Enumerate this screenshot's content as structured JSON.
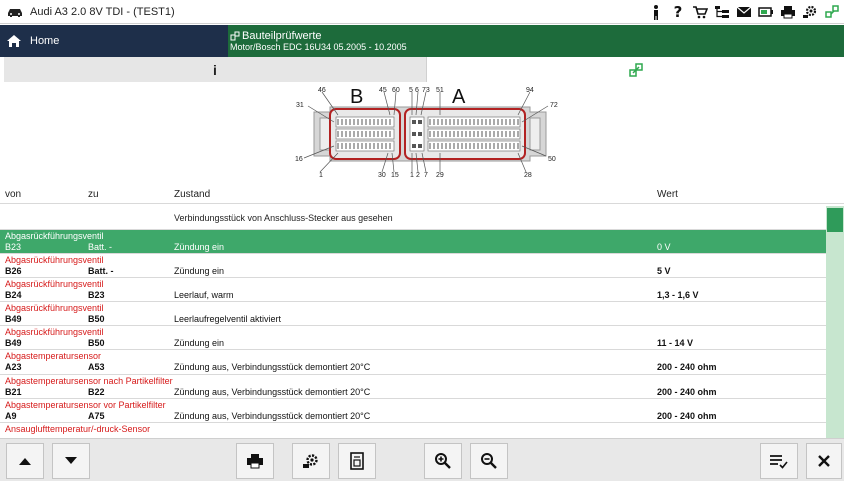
{
  "window": {
    "title": "Audi A3 2.0 8V TDI - (TEST1)"
  },
  "header": {
    "home_label": "Home",
    "module_title": "Bauteilprüfwerte",
    "module_subtitle": "Motor/Bosch EDC 16U34  05.2005 - 10.2005"
  },
  "tabs": {
    "info_label": "i"
  },
  "diagram": {
    "label_b": "B",
    "label_a": "A",
    "pins": [
      "46",
      "45",
      "60",
      "5",
      "6",
      "73",
      "51",
      "94",
      "31",
      "72",
      "16",
      "50",
      "1",
      "30",
      "15",
      "1",
      "2",
      "7",
      "29",
      "28"
    ]
  },
  "columns": {
    "von": "von",
    "zu": "zu",
    "zustand": "Zustand",
    "wert": "Wert"
  },
  "note": "Verbindungsstück von Anschluss-Stecker aus gesehen",
  "rows": [
    {
      "component": "Abgasrückführungsventil",
      "von": "B23",
      "zu": "Batt. -",
      "zustand": "Zündung ein",
      "wert": "0 V",
      "selected": true
    },
    {
      "component": "Abgasrückführungsventil",
      "von": "B26",
      "zu": "Batt. -",
      "zustand": "Zündung ein",
      "wert": "5 V"
    },
    {
      "component": "Abgasrückführungsventil",
      "von": "B24",
      "zu": "B23",
      "zustand": "Leerlauf, warm",
      "wert": "1,3 - 1,6 V"
    },
    {
      "component": "Abgasrückführungsventil",
      "von": "B49",
      "zu": "B50",
      "zustand": "Leerlaufregelventil aktiviert",
      "wert": ""
    },
    {
      "component": "Abgasrückführungsventil",
      "von": "B49",
      "zu": "B50",
      "zustand": "Zündung ein",
      "wert": "11 - 14 V"
    },
    {
      "component": "Abgastemperatursensor",
      "von": "A23",
      "zu": "A53",
      "zustand": "Zündung aus, Verbindungsstück demontiert 20°C",
      "wert": "200 - 240 ohm"
    },
    {
      "component": "Abgastemperatursensor nach Partikelfilter",
      "von": "B21",
      "zu": "B22",
      "zustand": "Zündung aus, Verbindungsstück demontiert 20°C",
      "wert": "200 - 240 ohm"
    },
    {
      "component": "Abgastemperatursensor vor Partikelfilter",
      "von": "A9",
      "zu": "A75",
      "zustand": "Zündung aus, Verbindungsstück demontiert 20°C",
      "wert": "200 - 240 ohm"
    },
    {
      "component": "Ansauglufttemperatur/-druck-Sensor",
      "von": "",
      "zu": "",
      "zustand": "",
      "wert": ""
    }
  ],
  "icons": {
    "car": "car-icon",
    "person": "person-icon",
    "help": "question-icon",
    "cart": "cart-icon",
    "tree": "tree-icon",
    "mail": "mail-icon",
    "battery": "battery-icon",
    "print": "print-icon",
    "settings": "settings-icon",
    "connect": "connect-icon"
  },
  "colors": {
    "home_bg": "#1e2f4a",
    "module_bg": "#1d6b3b",
    "selected_row": "#3ea86a",
    "component_red": "#d61a1a",
    "scroll_track": "#c7e6cf"
  }
}
